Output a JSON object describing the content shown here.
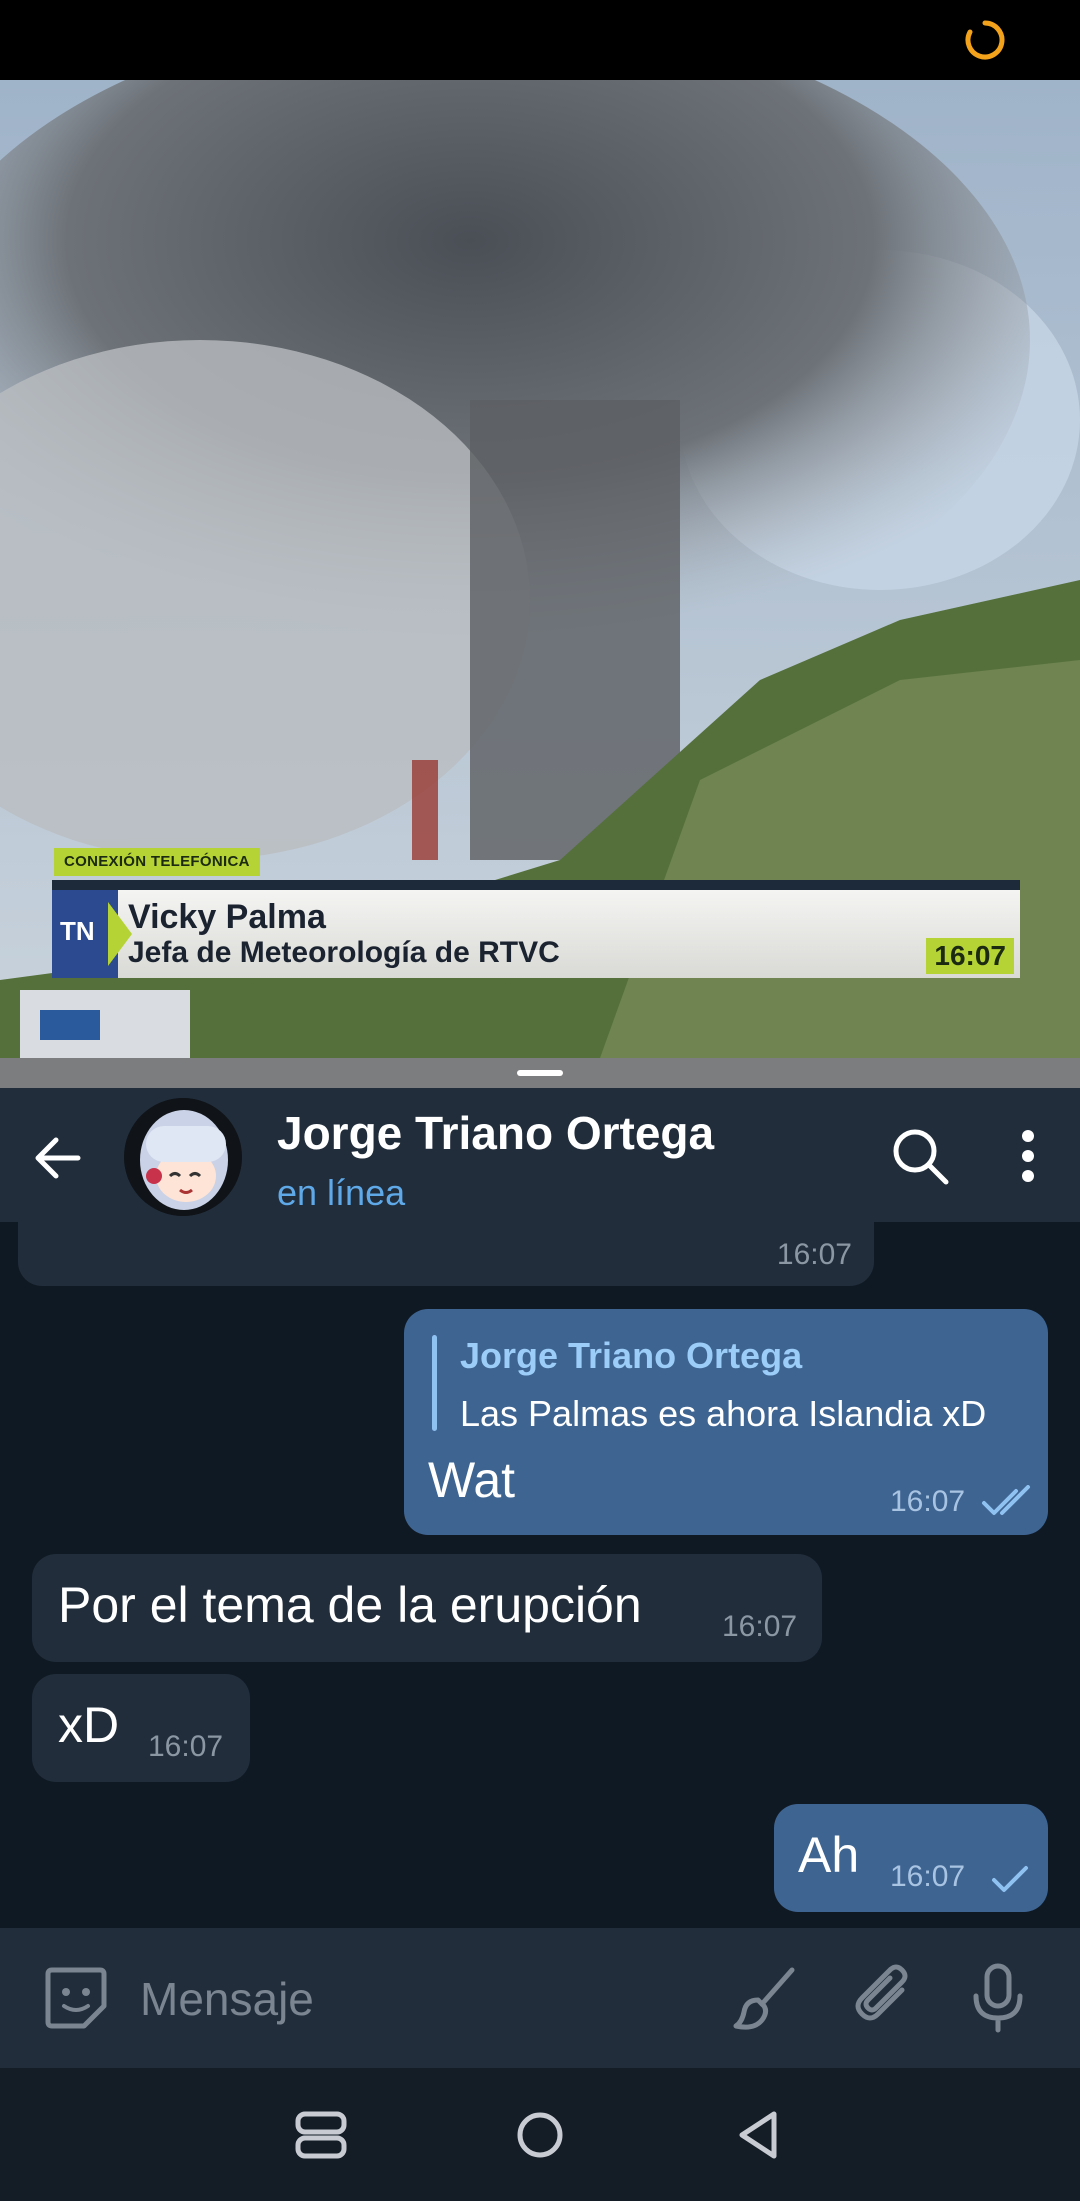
{
  "video": {
    "overlay_tag": "CONEXIÓN TELEFÓNICA",
    "channel_logo": "TN",
    "speaker_name": "Vicky Palma",
    "speaker_role": "Jefa de Meteorología de RTVC",
    "clock": "16:07"
  },
  "header": {
    "back_icon": "arrow-left-icon",
    "contact_name": "Jorge Triano Ortega",
    "status": "en línea",
    "search_icon": "search-icon",
    "more_icon": "more-vert-icon"
  },
  "messages": [
    {
      "direction": "in",
      "text": "",
      "time": "16:07",
      "partial": true
    },
    {
      "direction": "out",
      "reply_to_name": "Jorge Triano Ortega",
      "reply_to_text": "Las Palmas es ahora Islandia xD",
      "text": "Wat",
      "time": "16:07",
      "status": "read"
    },
    {
      "direction": "in",
      "text": "Por el tema de la erupción",
      "time": "16:07"
    },
    {
      "direction": "in",
      "text": "xD",
      "time": "16:07"
    },
    {
      "direction": "out",
      "text": "Ah",
      "time": "16:07",
      "status": "sent"
    }
  ],
  "composer": {
    "placeholder": "Mensaje",
    "sticker_icon": "sticker-icon",
    "brush_icon": "brush-icon",
    "attach_icon": "paperclip-icon",
    "mic_icon": "microphone-icon"
  },
  "navbar": {
    "recents_icon": "recents-icon",
    "home_icon": "home-icon",
    "back_icon": "nav-back-icon"
  },
  "colors": {
    "header_bg": "#212d3b",
    "chat_bg": "#0f1923",
    "outgoing_bubble": "#3e6492",
    "incoming_bubble": "#212d3b",
    "accent_blue": "#5fa9e8",
    "loader_orange": "#f2a21b"
  }
}
